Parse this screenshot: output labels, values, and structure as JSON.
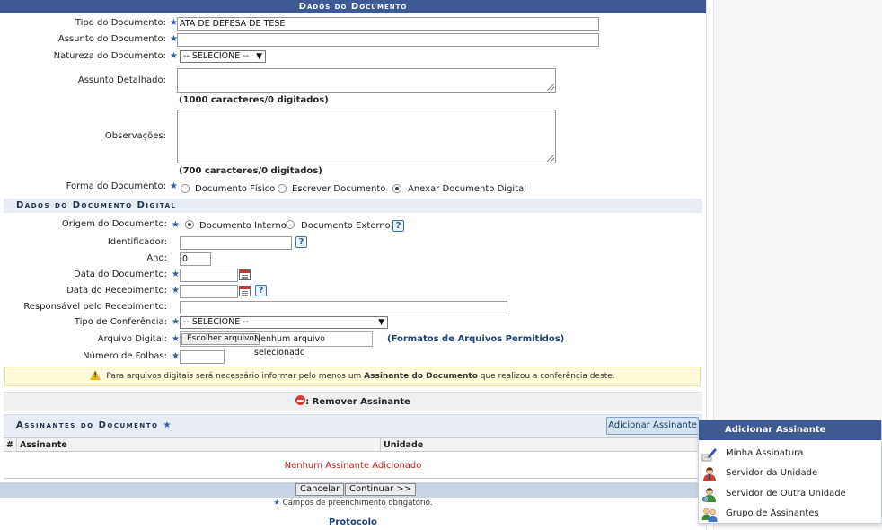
{
  "dados_documento": {
    "title": "Dados do Documento",
    "tipo_label": "Tipo do Documento:",
    "tipo_value": "ATA DE DEFESA DE TESE",
    "assunto_label": "Assunto do Documento:",
    "natureza_label": "Natureza do Documento:",
    "natureza_value": "-- SELECIONE --",
    "assunto_detalhado_label": "Assunto Detalhado:",
    "assunto_detalhado_counter": "(1000 caracteres/0 digitados)",
    "observacoes_label": "Observações:",
    "observacoes_counter": "(700 caracteres/0 digitados)",
    "forma_label": "Forma do Documento:",
    "forma_options": [
      "Documento Físico",
      "Escrever Documento",
      "Anexar Documento Digital"
    ],
    "forma_selected": "Anexar Documento Digital"
  },
  "dados_digital": {
    "title": "Dados do Documento Digital",
    "origem_label": "Origem do Documento:",
    "origem_options": [
      "Documento Interno",
      "Documento Externo"
    ],
    "origem_selected": "Documento Interno",
    "identificador_label": "Identificador:",
    "ano_label": "Ano:",
    "ano_value": "0",
    "data_documento_label": "Data do Documento:",
    "data_recebimento_label": "Data do Recebimento:",
    "responsavel_label": "Responsável pelo Recebimento:",
    "tipo_conferencia_label": "Tipo de Conferência:",
    "tipo_conferencia_value": "-- SELECIONE --",
    "arquivo_label": "Arquivo Digital:",
    "arquivo_button": "Escolher arquivo",
    "arquivo_status": "Nenhum arquivo selecionado",
    "formatos_link": "(Formatos de Arquivos Permitidos)",
    "folhas_label": "Número de Folhas:"
  },
  "warning": {
    "text_pre": "Para arquivos digitais será necessário informar pelo menos um ",
    "text_bold": "Assinante do Documento",
    "text_post": " que realizou a conferência deste."
  },
  "remove_assinante": ": Remover Assinante",
  "assinantes": {
    "title": "Assinantes do Documento",
    "add_button": "Adicionar Assinante",
    "columns": [
      "#",
      "Assinante",
      "Unidade"
    ],
    "empty_text": "Nenhum Assinante Adicionado"
  },
  "actions": {
    "cancel": "Cancelar",
    "continue": "Continuar >>"
  },
  "footer": {
    "required_note": "Campos de preenchimento obrigatório.",
    "link": "Protocolo"
  },
  "menu": {
    "title": "Adicionar Assinante",
    "items": [
      {
        "label": "Minha Assinatura",
        "icon": "pen-icon"
      },
      {
        "label": "Servidor da Unidade",
        "icon": "user-icon"
      },
      {
        "label": "Servidor de Outra Unidade",
        "icon": "user-other-icon"
      },
      {
        "label": "Grupo de Assinantes",
        "icon": "group-icon"
      }
    ]
  },
  "required_mark": "★",
  "help_mark": "?",
  "colors": {
    "header": "#3d5a93",
    "required": "#2c5fa8",
    "empty_text": "#c12121"
  }
}
